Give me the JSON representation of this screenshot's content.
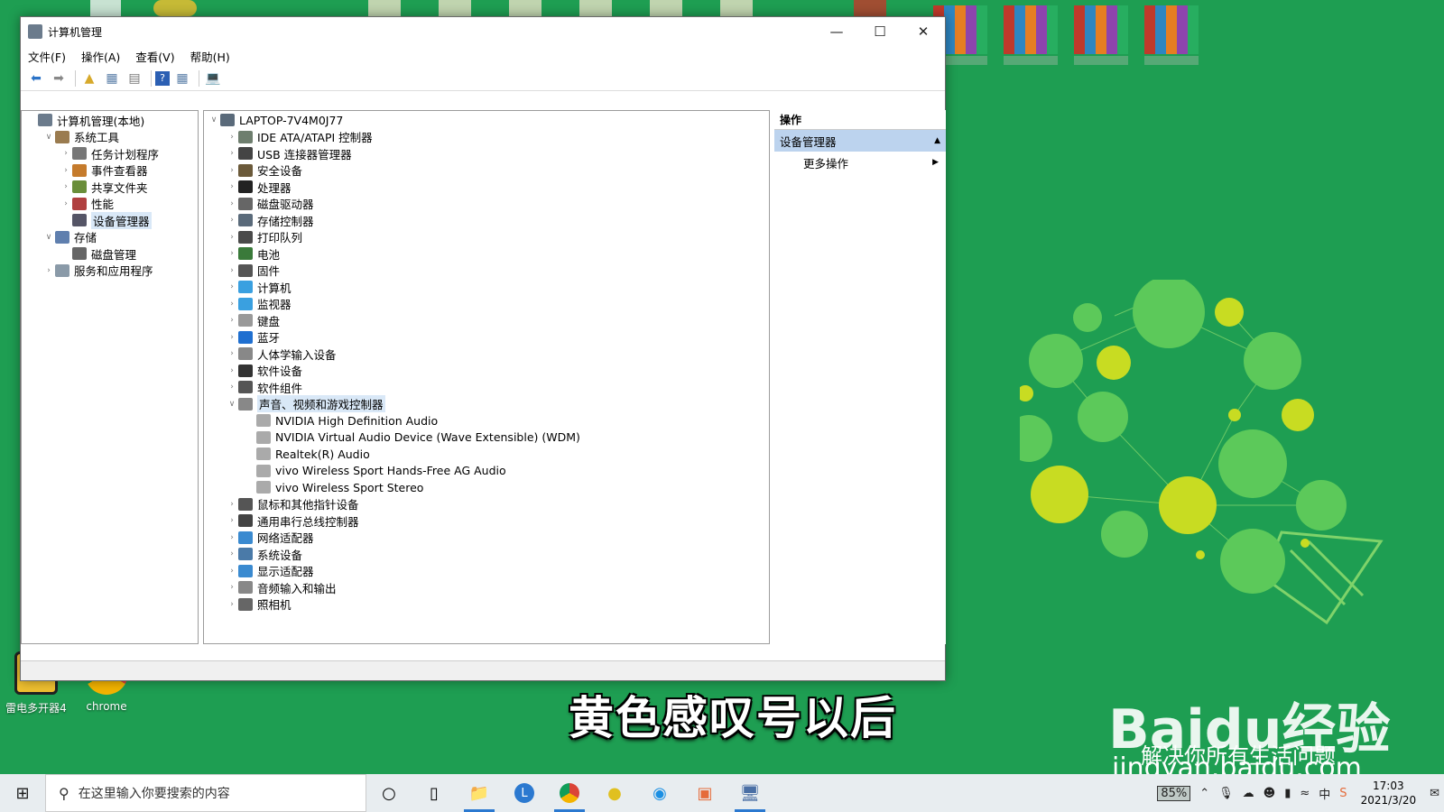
{
  "window": {
    "title": "计算机管理",
    "menu": [
      "文件(F)",
      "操作(A)",
      "查看(V)",
      "帮助(H)"
    ]
  },
  "left_tree": [
    {
      "label": "计算机管理(本地)",
      "level": 0,
      "exp": ""
    },
    {
      "label": "系统工具",
      "level": 1,
      "exp": "v"
    },
    {
      "label": "任务计划程序",
      "level": 2,
      "exp": ">"
    },
    {
      "label": "事件查看器",
      "level": 2,
      "exp": ">"
    },
    {
      "label": "共享文件夹",
      "level": 2,
      "exp": ">"
    },
    {
      "label": "性能",
      "level": 2,
      "exp": ">"
    },
    {
      "label": "设备管理器",
      "level": 2,
      "exp": "",
      "selected": true
    },
    {
      "label": "存储",
      "level": 1,
      "exp": "v"
    },
    {
      "label": "磁盘管理",
      "level": 2,
      "exp": ""
    },
    {
      "label": "服务和应用程序",
      "level": 1,
      "exp": ">"
    }
  ],
  "device_tree": {
    "root": "LAPTOP-7V4M0J77",
    "categories": [
      "IDE ATA/ATAPI 控制器",
      "USB 连接器管理器",
      "安全设备",
      "处理器",
      "磁盘驱动器",
      "存储控制器",
      "打印队列",
      "电池",
      "固件",
      "计算机",
      "监视器",
      "键盘",
      "蓝牙",
      "人体学输入设备",
      "软件设备",
      "软件组件"
    ],
    "expanded_category": "声音、视频和游戏控制器",
    "expanded_children": [
      "NVIDIA High Definition Audio",
      "NVIDIA Virtual Audio Device (Wave Extensible) (WDM)",
      "Realtek(R) Audio",
      "vivo Wireless Sport Hands-Free AG Audio",
      "vivo Wireless Sport Stereo"
    ],
    "categories_after": [
      "鼠标和其他指针设备",
      "通用串行总线控制器",
      "网络适配器",
      "系统设备",
      "显示适配器",
      "音频输入和输出",
      "照相机"
    ]
  },
  "actions": {
    "header": "操作",
    "section": "设备管理器",
    "item": "更多操作"
  },
  "desktop": {
    "icons": [
      "雷电多开器4",
      "chrome"
    ],
    "subtitle": "黄色感叹号以后",
    "watermark_title": "Baidu经验",
    "watermark_sub": "解决你所有生活问题",
    "watermark_domain": "jingyan.baidu.com"
  },
  "taskbar": {
    "search_placeholder": "在这里输入你要搜索的内容",
    "battery": "85%",
    "time": "17:03",
    "date": "2021/3/20"
  }
}
